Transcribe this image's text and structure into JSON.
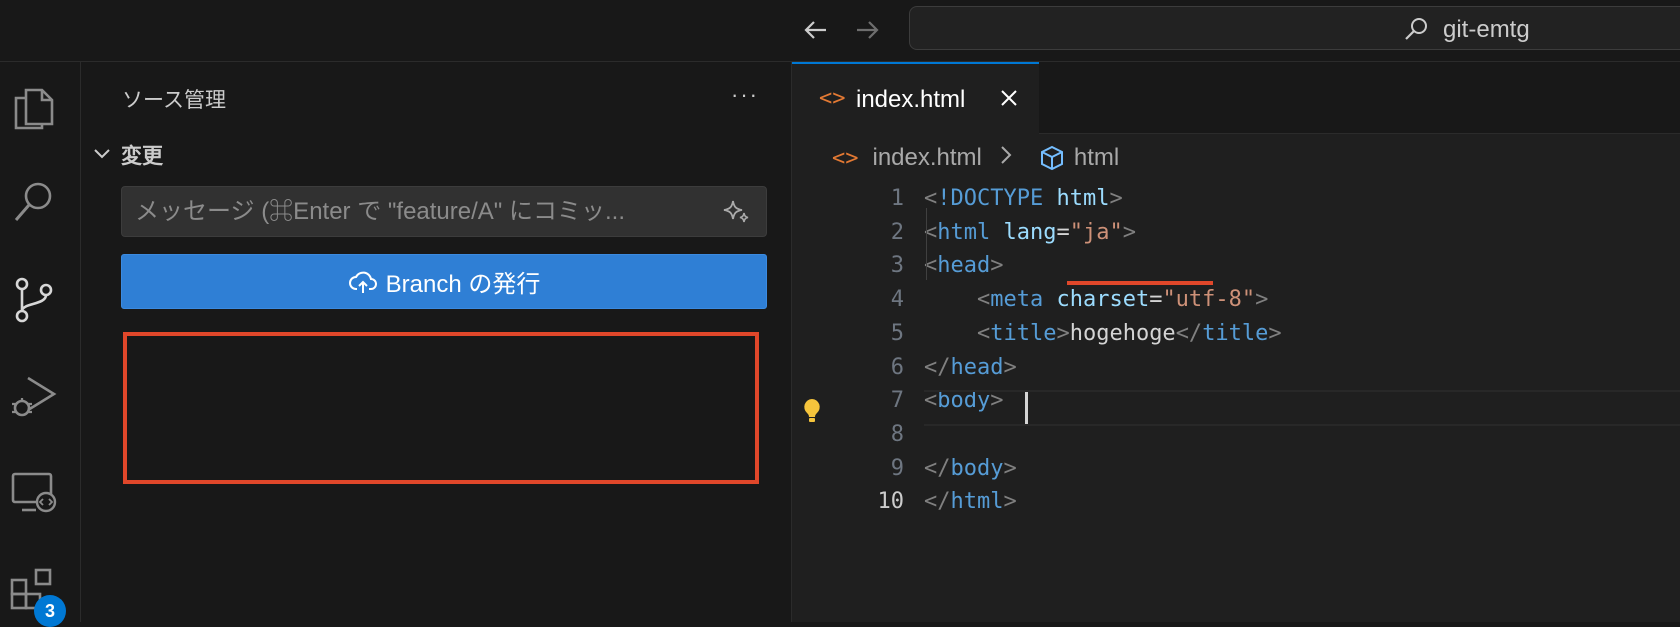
{
  "titlebar": {
    "search_title": "git-emtg"
  },
  "activity_bar": {
    "badge_count": "3"
  },
  "sidebar": {
    "title": "ソース管理",
    "more": "···",
    "section_title": "変更",
    "commit_placeholder": "メッセージ (⌘Enter で \"feature/A\" にコミッ...",
    "publish_label": "Branch の発行"
  },
  "editor": {
    "tab_name": "index.html",
    "breadcrumb": {
      "file": "index.html",
      "symbol": "html"
    },
    "lines": [
      {
        "n": "1",
        "tokens": [
          [
            "punc",
            "<"
          ],
          [
            "tag",
            "!DOCTYPE"
          ],
          [
            "txt",
            " "
          ],
          [
            "attr",
            "html"
          ],
          [
            "punc",
            ">"
          ]
        ]
      },
      {
        "n": "2",
        "tokens": [
          [
            "punc",
            "<"
          ],
          [
            "tag",
            "html"
          ],
          [
            "txt",
            " "
          ],
          [
            "attr",
            "lang"
          ],
          [
            "txt",
            "="
          ],
          [
            "str",
            "\"ja\""
          ],
          [
            "punc",
            ">"
          ]
        ]
      },
      {
        "n": "3",
        "tokens": [
          [
            "punc",
            "<"
          ],
          [
            "tag",
            "head"
          ],
          [
            "punc",
            ">"
          ]
        ]
      },
      {
        "n": "4",
        "tokens": [
          [
            "txt",
            "    "
          ],
          [
            "punc",
            "<"
          ],
          [
            "tag",
            "meta"
          ],
          [
            "txt",
            " "
          ],
          [
            "attr",
            "charset"
          ],
          [
            "txt",
            "="
          ],
          [
            "str",
            "\"utf-8\""
          ],
          [
            "punc",
            ">"
          ]
        ]
      },
      {
        "n": "5",
        "tokens": [
          [
            "txt",
            "    "
          ],
          [
            "punc",
            "<"
          ],
          [
            "tag",
            "title"
          ],
          [
            "punc",
            ">"
          ],
          [
            "txt",
            "hogehoge"
          ],
          [
            "punc",
            "</"
          ],
          [
            "tag",
            "title"
          ],
          [
            "punc",
            ">"
          ]
        ]
      },
      {
        "n": "6",
        "tokens": [
          [
            "punc",
            "</"
          ],
          [
            "tag",
            "head"
          ],
          [
            "punc",
            ">"
          ]
        ]
      },
      {
        "n": "7",
        "tokens": [
          [
            "punc",
            "<"
          ],
          [
            "tag",
            "body"
          ],
          [
            "punc",
            ">"
          ]
        ]
      },
      {
        "n": "8",
        "tokens": []
      },
      {
        "n": "9",
        "tokens": [
          [
            "punc",
            "</"
          ],
          [
            "tag",
            "body"
          ],
          [
            "punc",
            ">"
          ]
        ]
      },
      {
        "n": "10",
        "tokens": [
          [
            "punc",
            "</"
          ],
          [
            "tag",
            "html"
          ],
          [
            "punc",
            ">"
          ]
        ]
      }
    ],
    "active_line": "10"
  }
}
